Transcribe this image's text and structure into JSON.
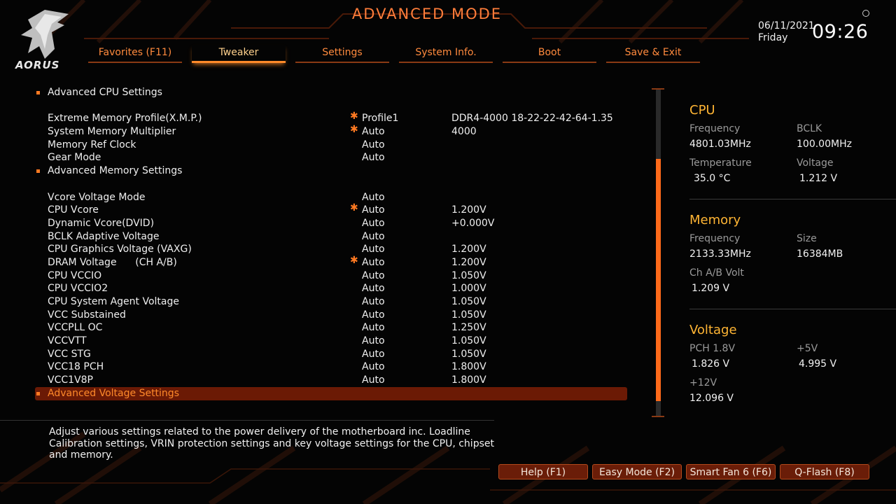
{
  "header": {
    "mode_title": "ADVANCED MODE",
    "logo_text": "AORUS",
    "date": "06/11/2021",
    "day": "Friday",
    "time": "09:26"
  },
  "tabs": [
    {
      "label": "Favorites (F11)",
      "active": false
    },
    {
      "label": "Tweaker",
      "active": true
    },
    {
      "label": "Settings",
      "active": false
    },
    {
      "label": "System Info.",
      "active": false
    },
    {
      "label": "Boot",
      "active": false
    },
    {
      "label": "Save & Exit",
      "active": false
    }
  ],
  "settings": [
    {
      "label": "Advanced CPU Settings",
      "bullet": true
    },
    {
      "spacer": true
    },
    {
      "label": "Extreme Memory Profile(X.M.P.)",
      "star": true,
      "value": "Profile1",
      "info": "DDR4-4000 18-22-22-42-64-1.35"
    },
    {
      "label": "System Memory Multiplier",
      "star": true,
      "value": "Auto",
      "info": "4000"
    },
    {
      "label": "Memory Ref Clock",
      "value": "Auto"
    },
    {
      "label": "Gear Mode",
      "value": "Auto"
    },
    {
      "label": "Advanced Memory Settings",
      "bullet": true
    },
    {
      "spacer": true
    },
    {
      "label": "Vcore Voltage Mode",
      "value": "Auto"
    },
    {
      "label": "CPU Vcore",
      "star": true,
      "value": "Auto",
      "info": "1.200V"
    },
    {
      "label": "Dynamic Vcore(DVID)",
      "value": "Auto",
      "info": "+0.000V"
    },
    {
      "label": "BCLK Adaptive Voltage",
      "value": "Auto"
    },
    {
      "label": "CPU Graphics Voltage (VAXG)",
      "value": "Auto",
      "info": "1.200V"
    },
    {
      "label": "DRAM Voltage      (CH A/B)",
      "star": true,
      "value": "Auto",
      "info": "1.200V"
    },
    {
      "label": "CPU VCCIO",
      "value": "Auto",
      "info": "1.050V"
    },
    {
      "label": "CPU VCCIO2",
      "value": "Auto",
      "info": "1.000V"
    },
    {
      "label": "CPU System Agent Voltage",
      "value": "Auto",
      "info": "1.050V"
    },
    {
      "label": "VCC Substained",
      "value": "Auto",
      "info": "1.050V"
    },
    {
      "label": "VCCPLL OC",
      "value": "Auto",
      "info": "1.250V"
    },
    {
      "label": "VCCVTT",
      "value": "Auto",
      "info": "1.050V"
    },
    {
      "label": "VCC STG",
      "value": "Auto",
      "info": "1.050V"
    },
    {
      "label": "VCC18 PCH",
      "value": "Auto",
      "info": "1.800V"
    },
    {
      "label": "VCC1V8P",
      "value": "Auto",
      "info": "1.800V"
    },
    {
      "label": "Advanced Voltage Settings",
      "bullet": true,
      "selected": true
    }
  ],
  "panel": {
    "cpu": {
      "title": "CPU",
      "frequency_label": "Frequency",
      "frequency": "4801.03MHz",
      "bclk_label": "BCLK",
      "bclk": "100.00MHz",
      "temperature_label": "Temperature",
      "temperature": "35.0 °C",
      "voltage_label": "Voltage",
      "voltage": "1.212 V"
    },
    "memory": {
      "title": "Memory",
      "frequency_label": "Frequency",
      "frequency": "2133.33MHz",
      "size_label": "Size",
      "size": "16384MB",
      "chab_label": "Ch A/B Volt",
      "chab": "1.209 V"
    },
    "voltage": {
      "title": "Voltage",
      "pch_label": "PCH 1.8V",
      "pch": "1.826 V",
      "p5_label": "+5V",
      "p5": "4.995 V",
      "p12_label": "+12V",
      "p12": "12.096 V"
    }
  },
  "help_text": "Adjust various settings related to the power delivery of the motherboard inc. Loadline Calibration settings, VRIN protection settings and key voltage settings for the CPU, chipset and memory.",
  "buttons": {
    "help": "Help (F1)",
    "easy": "Easy Mode (F2)",
    "smartfan": "Smart Fan 6 (F6)",
    "qflash": "Q-Flash (F8)"
  },
  "colors": {
    "accent": "#ff7a22",
    "panel_title": "#ffb534",
    "selected_row": "#6b1a05"
  }
}
